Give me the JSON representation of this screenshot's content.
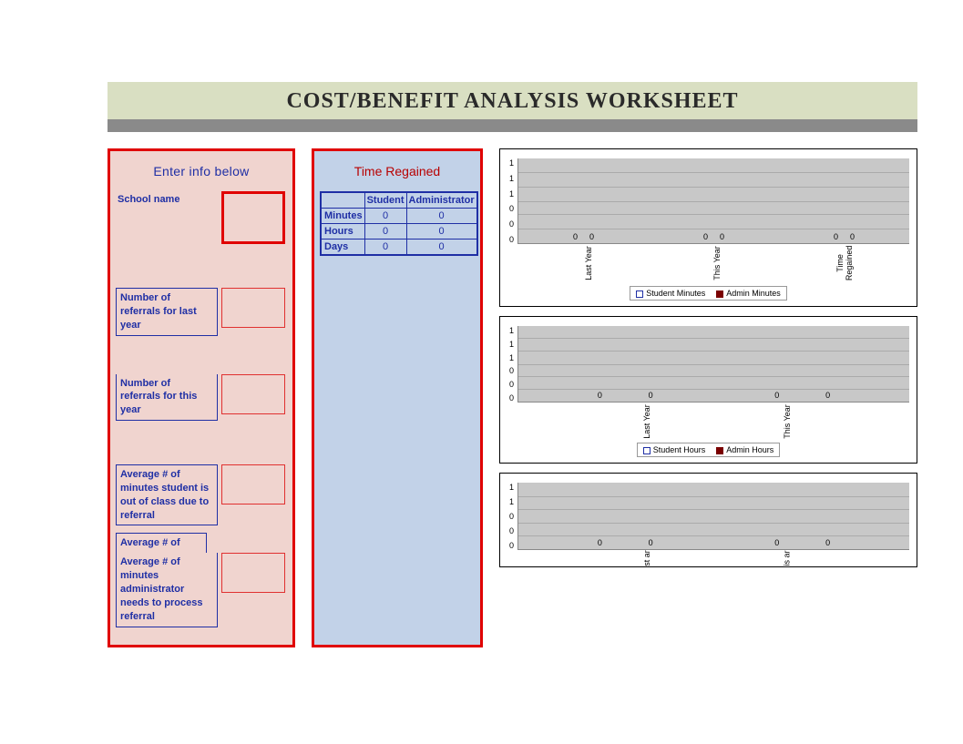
{
  "title": "COST/BENEFIT ANALYSIS WORKSHEET",
  "left_panel": {
    "header": "Enter info below",
    "fields": {
      "school_name": "School name",
      "referrals_last": "Number of referrals for last year",
      "referrals_this": "Number of referrals for this year",
      "avg_student_out": "Average #  of minutes student is out of class due to referral",
      "avg_short": "Average # of",
      "avg_admin_process": "Average # of minutes administrator needs  to process referral"
    }
  },
  "mid_panel": {
    "header": "Time Regained",
    "table": {
      "col1": "Student",
      "col2": "Administrator",
      "rows": [
        {
          "label": "Minutes",
          "student": "0",
          "admin": "0"
        },
        {
          "label": "Hours",
          "student": "0",
          "admin": "0"
        },
        {
          "label": "Days",
          "student": "0",
          "admin": "0"
        }
      ]
    }
  },
  "chart_data": [
    {
      "type": "bar",
      "categories": [
        "Last Year",
        "This Year",
        "Time Regained"
      ],
      "series": [
        {
          "name": "Student Minutes",
          "values": [
            0,
            0,
            0
          ]
        },
        {
          "name": "Admin Minutes",
          "values": [
            0,
            0,
            0
          ]
        }
      ],
      "ylim": [
        0,
        1
      ],
      "yticks": [
        "1",
        "1",
        "1",
        "0",
        "0",
        "0"
      ]
    },
    {
      "type": "bar",
      "categories": [
        "Last Year",
        "This Year"
      ],
      "series": [
        {
          "name": "Student Hours",
          "values": [
            0,
            0
          ]
        },
        {
          "name": "Admin Hours",
          "values": [
            0,
            0
          ]
        }
      ],
      "ylim": [
        0,
        1
      ],
      "yticks": [
        "1",
        "1",
        "1",
        "0",
        "0",
        "0"
      ]
    },
    {
      "type": "bar",
      "categories": [
        "st ar",
        "is ar"
      ],
      "series": [
        {
          "name": "",
          "values": [
            0,
            0
          ]
        },
        {
          "name": "",
          "values": [
            0,
            0
          ]
        }
      ],
      "ylim": [
        0,
        1
      ],
      "yticks": [
        "1",
        "1",
        "0",
        "0",
        "0"
      ]
    }
  ]
}
